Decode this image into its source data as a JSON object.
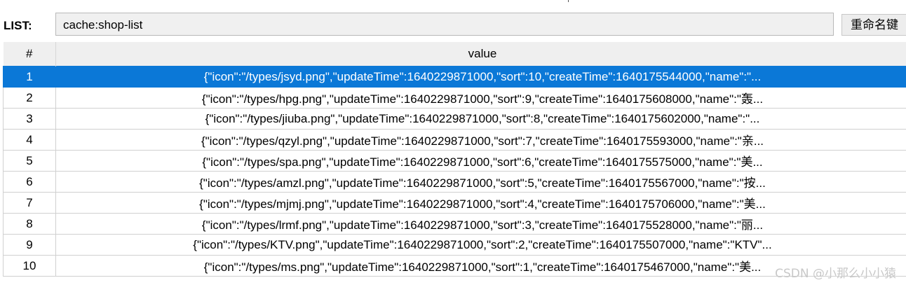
{
  "list_label": "LIST:",
  "key_value": "cache:shop-list",
  "rename_button": "重命名键",
  "table": {
    "headers": [
      "#",
      "value"
    ],
    "selected_row": 0,
    "rows": [
      {
        "index": "1",
        "value": "{\"icon\":\"/types/jsyd.png\",\"updateTime\":1640229871000,\"sort\":10,\"createTime\":1640175544000,\"name\":\"..."
      },
      {
        "index": "2",
        "value": "{\"icon\":\"/types/hpg.png\",\"updateTime\":1640229871000,\"sort\":9,\"createTime\":1640175608000,\"name\":\"轰..."
      },
      {
        "index": "3",
        "value": "{\"icon\":\"/types/jiuba.png\",\"updateTime\":1640229871000,\"sort\":8,\"createTime\":1640175602000,\"name\":\"..."
      },
      {
        "index": "4",
        "value": "{\"icon\":\"/types/qzyl.png\",\"updateTime\":1640229871000,\"sort\":7,\"createTime\":1640175593000,\"name\":\"亲..."
      },
      {
        "index": "5",
        "value": "{\"icon\":\"/types/spa.png\",\"updateTime\":1640229871000,\"sort\":6,\"createTime\":1640175575000,\"name\":\"美..."
      },
      {
        "index": "6",
        "value": "{\"icon\":\"/types/amzl.png\",\"updateTime\":1640229871000,\"sort\":5,\"createTime\":1640175567000,\"name\":\"按..."
      },
      {
        "index": "7",
        "value": "{\"icon\":\"/types/mjmj.png\",\"updateTime\":1640229871000,\"sort\":4,\"createTime\":1640175706000,\"name\":\"美..."
      },
      {
        "index": "8",
        "value": "{\"icon\":\"/types/lrmf.png\",\"updateTime\":1640229871000,\"sort\":3,\"createTime\":1640175528000,\"name\":\"丽..."
      },
      {
        "index": "9",
        "value": "{\"icon\":\"/types/KTV.png\",\"updateTime\":1640229871000,\"sort\":2,\"createTime\":1640175507000,\"name\":\"KTV\"..."
      },
      {
        "index": "10",
        "value": "{\"icon\":\"/types/ms.png\",\"updateTime\":1640229871000,\"sort\":1,\"createTime\":1640175467000,\"name\":\"美..."
      }
    ]
  },
  "watermark": "CSDN @小那么小小猿",
  "colors": {
    "selection": "#0b78d7",
    "header_bg": "#efefef"
  }
}
